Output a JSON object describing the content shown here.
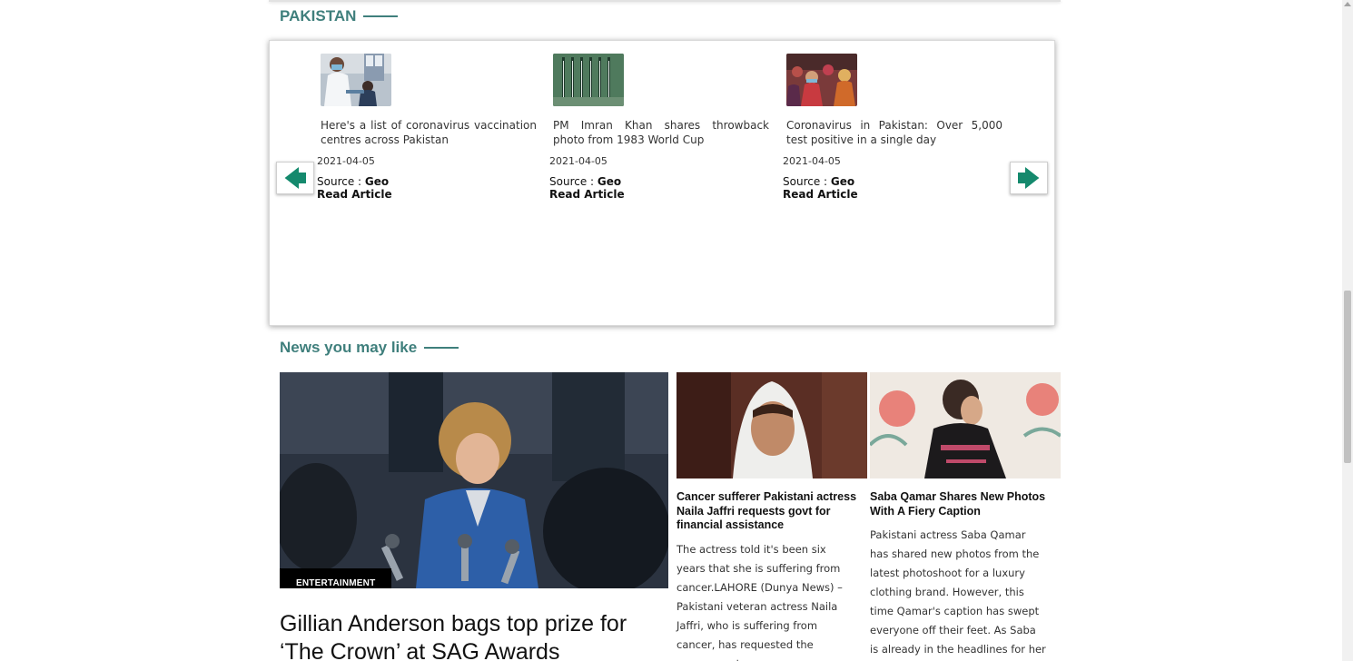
{
  "section_pakistan": {
    "heading": "PAKISTAN"
  },
  "carousel": {
    "prev_label": "previous",
    "next_label": "next",
    "articles": [
      {
        "title": "Here's a list of coronavirus vaccination centres across Pakistan",
        "date": "2021-04-05",
        "source_prefix": "Source : ",
        "source": "Geo",
        "read_label": "Read Article",
        "thumb_icon": "lab-worker-photo"
      },
      {
        "title": "PM Imran Khan shares throwback photo from 1983 World Cup",
        "date": "2021-04-05",
        "source_prefix": "Source : ",
        "source": "Geo",
        "read_label": "Read Article",
        "thumb_icon": "parade-photo"
      },
      {
        "title": "Coronavirus in Pakistan: Over 5,000 test positive in a single day",
        "date": "2021-04-05",
        "source_prefix": "Source : ",
        "source": "Geo",
        "read_label": "Read Article",
        "thumb_icon": "crowd-photo"
      }
    ]
  },
  "section_news": {
    "heading": "News you may like"
  },
  "featured": {
    "category": "ENTERTAINMENT",
    "title": "Gillian Anderson bags top prize for ‘The Crown’ at SAG Awards"
  },
  "side_articles": [
    {
      "title": "Cancer sufferer Pakistani actress Naila Jaffri requests govt for financial assistance",
      "excerpt": "The actress told it's been six years that she is suffering from cancer.LAHORE (Dunya News) – Pakistani veteran actress Naila Jaffri, who is suffering from cancer, has requested the government an..."
    },
    {
      "title": "Saba Qamar Shares New Photos With A Fiery Caption",
      "excerpt": "Pakistani actress Saba Qamar has shared new photos from the latest photoshoot for a luxury clothing brand. However, this time Qamar's caption has swept everyone off their feet. As Saba is already in the headlines for her relationship with"
    }
  ],
  "colors": {
    "accent": "#3f7f7c",
    "arrow_green": "#0f8a6c"
  }
}
